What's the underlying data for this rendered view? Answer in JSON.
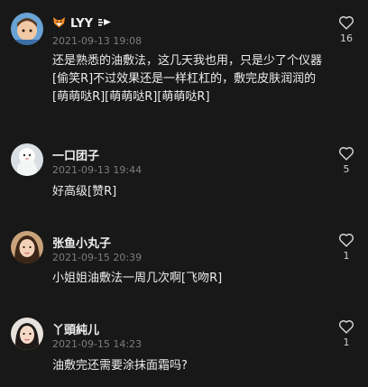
{
  "comments": [
    {
      "username": "LYY",
      "date": "2021-09-13 19:08",
      "text": "还是熟悉的油敷法，这几天我也用，只是少了个仪器[偷笑R]不过效果还是一样杠杠的，敷完皮肤润润的[萌萌哒R][萌萌哒R][萌萌哒R]",
      "likes": "16",
      "avatar_icon": "child-avatar-icon"
    },
    {
      "username": "一口团子",
      "date": "2021-09-13 19:44",
      "text": "好高级[赞R]",
      "likes": "5",
      "avatar_icon": "snowman-avatar-icon"
    },
    {
      "username": "张鱼小丸子",
      "date": "2021-09-15 20:39",
      "text": "小姐姐油敷法一周几次啊[飞吻R]",
      "likes": "1",
      "avatar_icon": "girl-avatar-icon"
    },
    {
      "username": "丫頭純儿",
      "date": "2021-09-15 14:23",
      "text": "油敷完还需要涂抹面霜吗?",
      "likes": "1",
      "avatar_icon": "woman-avatar-icon"
    }
  ],
  "colors": {
    "background": "#181818",
    "text": "#ececec",
    "meta": "#7d7d7d"
  }
}
